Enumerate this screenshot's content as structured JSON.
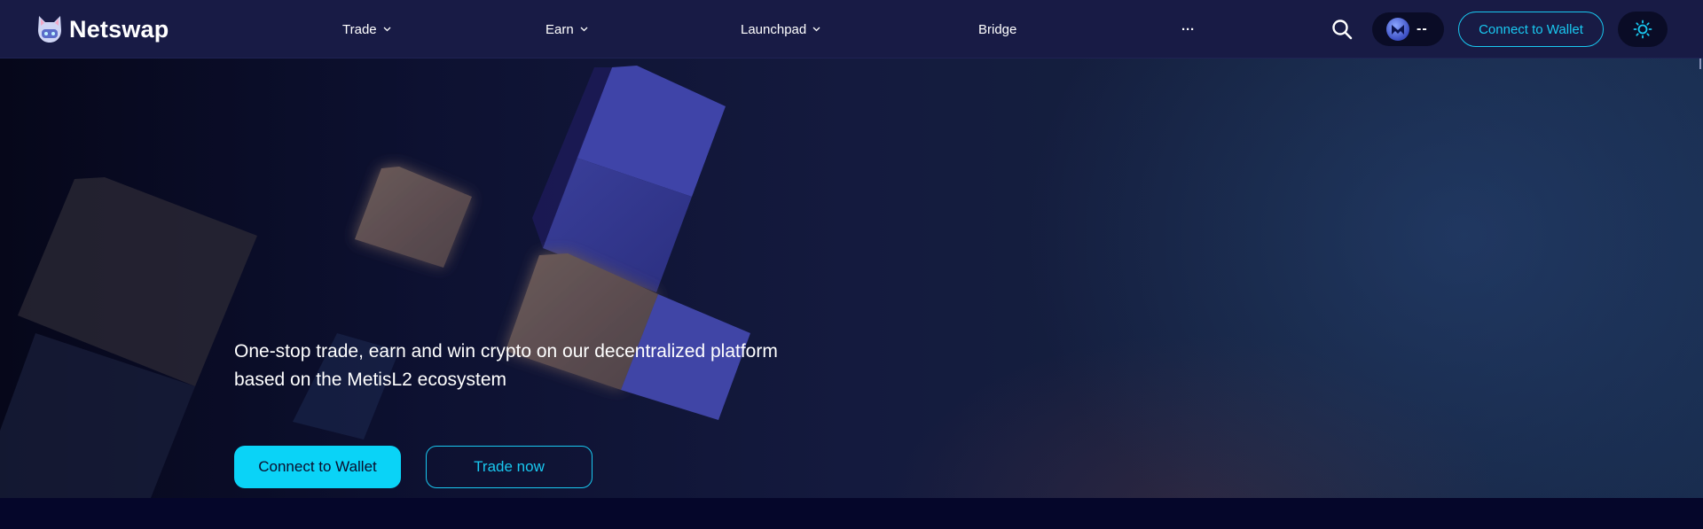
{
  "brand": {
    "name": "Netswap",
    "icon": "netswap-cat-icon"
  },
  "nav": {
    "items": [
      {
        "label": "Trade",
        "has_dropdown": true
      },
      {
        "label": "Earn",
        "has_dropdown": true
      },
      {
        "label": "Launchpad",
        "has_dropdown": true
      },
      {
        "label": "Bridge",
        "has_dropdown": false
      },
      {
        "label": "···",
        "has_dropdown": false
      }
    ]
  },
  "header_actions": {
    "search_icon": "search-icon",
    "metis_balance": "--",
    "connect_label": "Connect to Wallet",
    "theme_icon": "sun-icon"
  },
  "hero": {
    "headline": "One-stop trade, earn and win crypto on our decentralized platform based on the MetisL2 ecosystem",
    "primary_cta": "Connect to Wallet",
    "secondary_cta": "Trade now"
  },
  "colors": {
    "accent": "#19c8f0",
    "primary_button": "#0ad3f7",
    "header_bg": "#181b45",
    "page_bg": "#05062a"
  }
}
